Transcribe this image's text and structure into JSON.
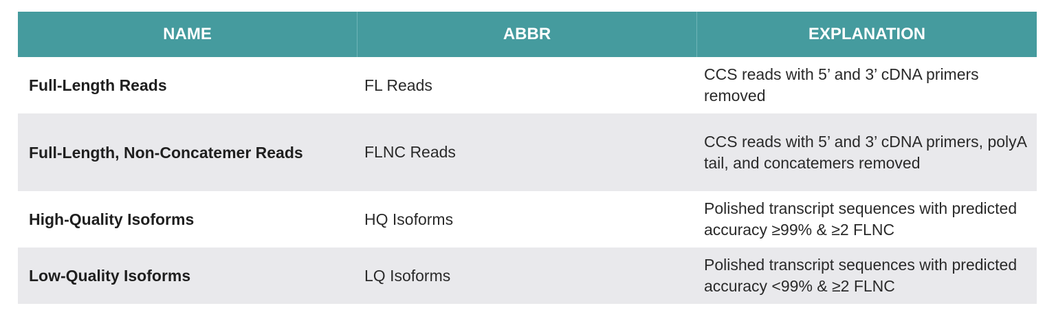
{
  "table": {
    "headers": [
      "NAME",
      "ABBR",
      "EXPLANATION"
    ],
    "rows": [
      {
        "name": "Full-Length Reads",
        "abbr": "FL Reads",
        "explanation": "CCS reads with 5’ and 3’ cDNA primers removed"
      },
      {
        "name": "Full-Length, Non-Concatemer Reads",
        "abbr": "FLNC Reads",
        "explanation": "CCS reads with 5’ and 3’ cDNA primers, polyA tail, and concatemers removed"
      },
      {
        "name": "High-Quality Isoforms",
        "abbr": "HQ Isoforms",
        "explanation": "Polished transcript sequences with predicted accuracy ≥99% & ≥2 FLNC"
      },
      {
        "name": "Low-Quality Isoforms",
        "abbr": "LQ Isoforms",
        "explanation": "Polished transcript sequences with predicted accuracy <99% & ≥2 FLNC"
      }
    ]
  },
  "colors": {
    "header_bg": "#459b9e",
    "stripe_bg": "#e9e9ec"
  }
}
